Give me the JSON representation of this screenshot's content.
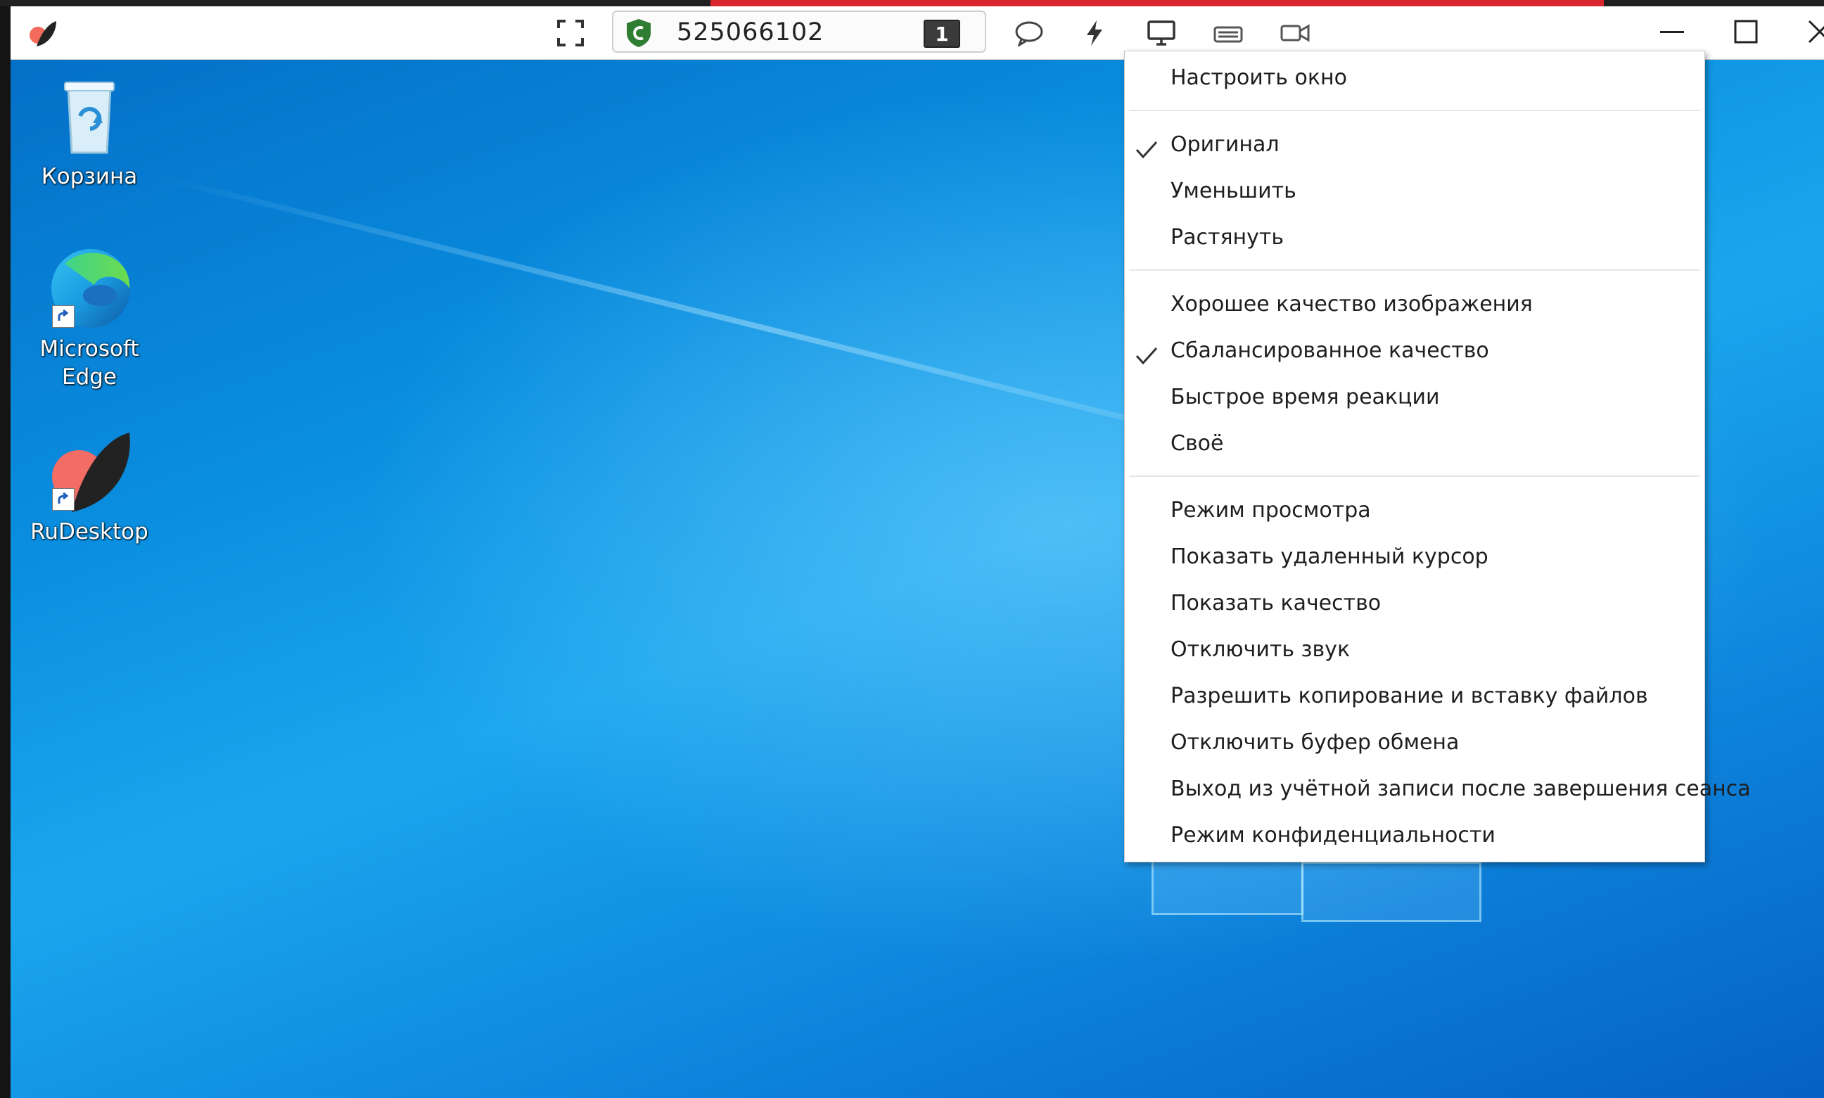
{
  "colors": {
    "titlebar_bg": "#ffffff",
    "accent_red": "#d8262c",
    "desktop_blue": "#0a8fe0",
    "menu_bg": "#ffffff",
    "shield_green": "#2e7d32"
  },
  "toolbar": {
    "connection_id": "525066102",
    "monitor_number": "1",
    "icons": [
      "app-logo-icon",
      "fullscreen-icon",
      "shield-icon",
      "chat-icon",
      "lightning-icon",
      "display-icon",
      "keyboard-icon",
      "video-icon",
      "minimize-icon",
      "maximize-icon",
      "close-icon"
    ]
  },
  "desktop": {
    "icons": [
      {
        "label_line1": "Корзина",
        "label_line2": "",
        "icon": "recycle-bin-icon"
      },
      {
        "label_line1": "Microsoft",
        "label_line2": "Edge",
        "icon": "edge-icon"
      },
      {
        "label_line1": "RuDesktop",
        "label_line2": "",
        "icon": "rudesktop-icon"
      }
    ]
  },
  "menu": {
    "items": [
      {
        "label": "Настроить окно",
        "checked": false
      },
      {
        "label": "Оригинал",
        "checked": true
      },
      {
        "label": "Уменьшить",
        "checked": false
      },
      {
        "label": "Растянуть",
        "checked": false
      },
      {
        "label": "Хорошее качество изображения",
        "checked": false
      },
      {
        "label": "Сбалансированное качество",
        "checked": true
      },
      {
        "label": "Быстрое время реакции",
        "checked": false
      },
      {
        "label": "Своё",
        "checked": false
      },
      {
        "label": "Режим просмотра",
        "checked": false
      },
      {
        "label": "Показать удаленный курсор",
        "checked": false
      },
      {
        "label": "Показать качество",
        "checked": false
      },
      {
        "label": "Отключить звук",
        "checked": false
      },
      {
        "label": "Разрешить копирование и вставку файлов",
        "checked": false
      },
      {
        "label": "Отключить буфер обмена",
        "checked": false
      },
      {
        "label": "Выход из учётной записи после завершения сеанса",
        "checked": false
      },
      {
        "label": "Режим конфиденциальности",
        "checked": false
      }
    ]
  }
}
